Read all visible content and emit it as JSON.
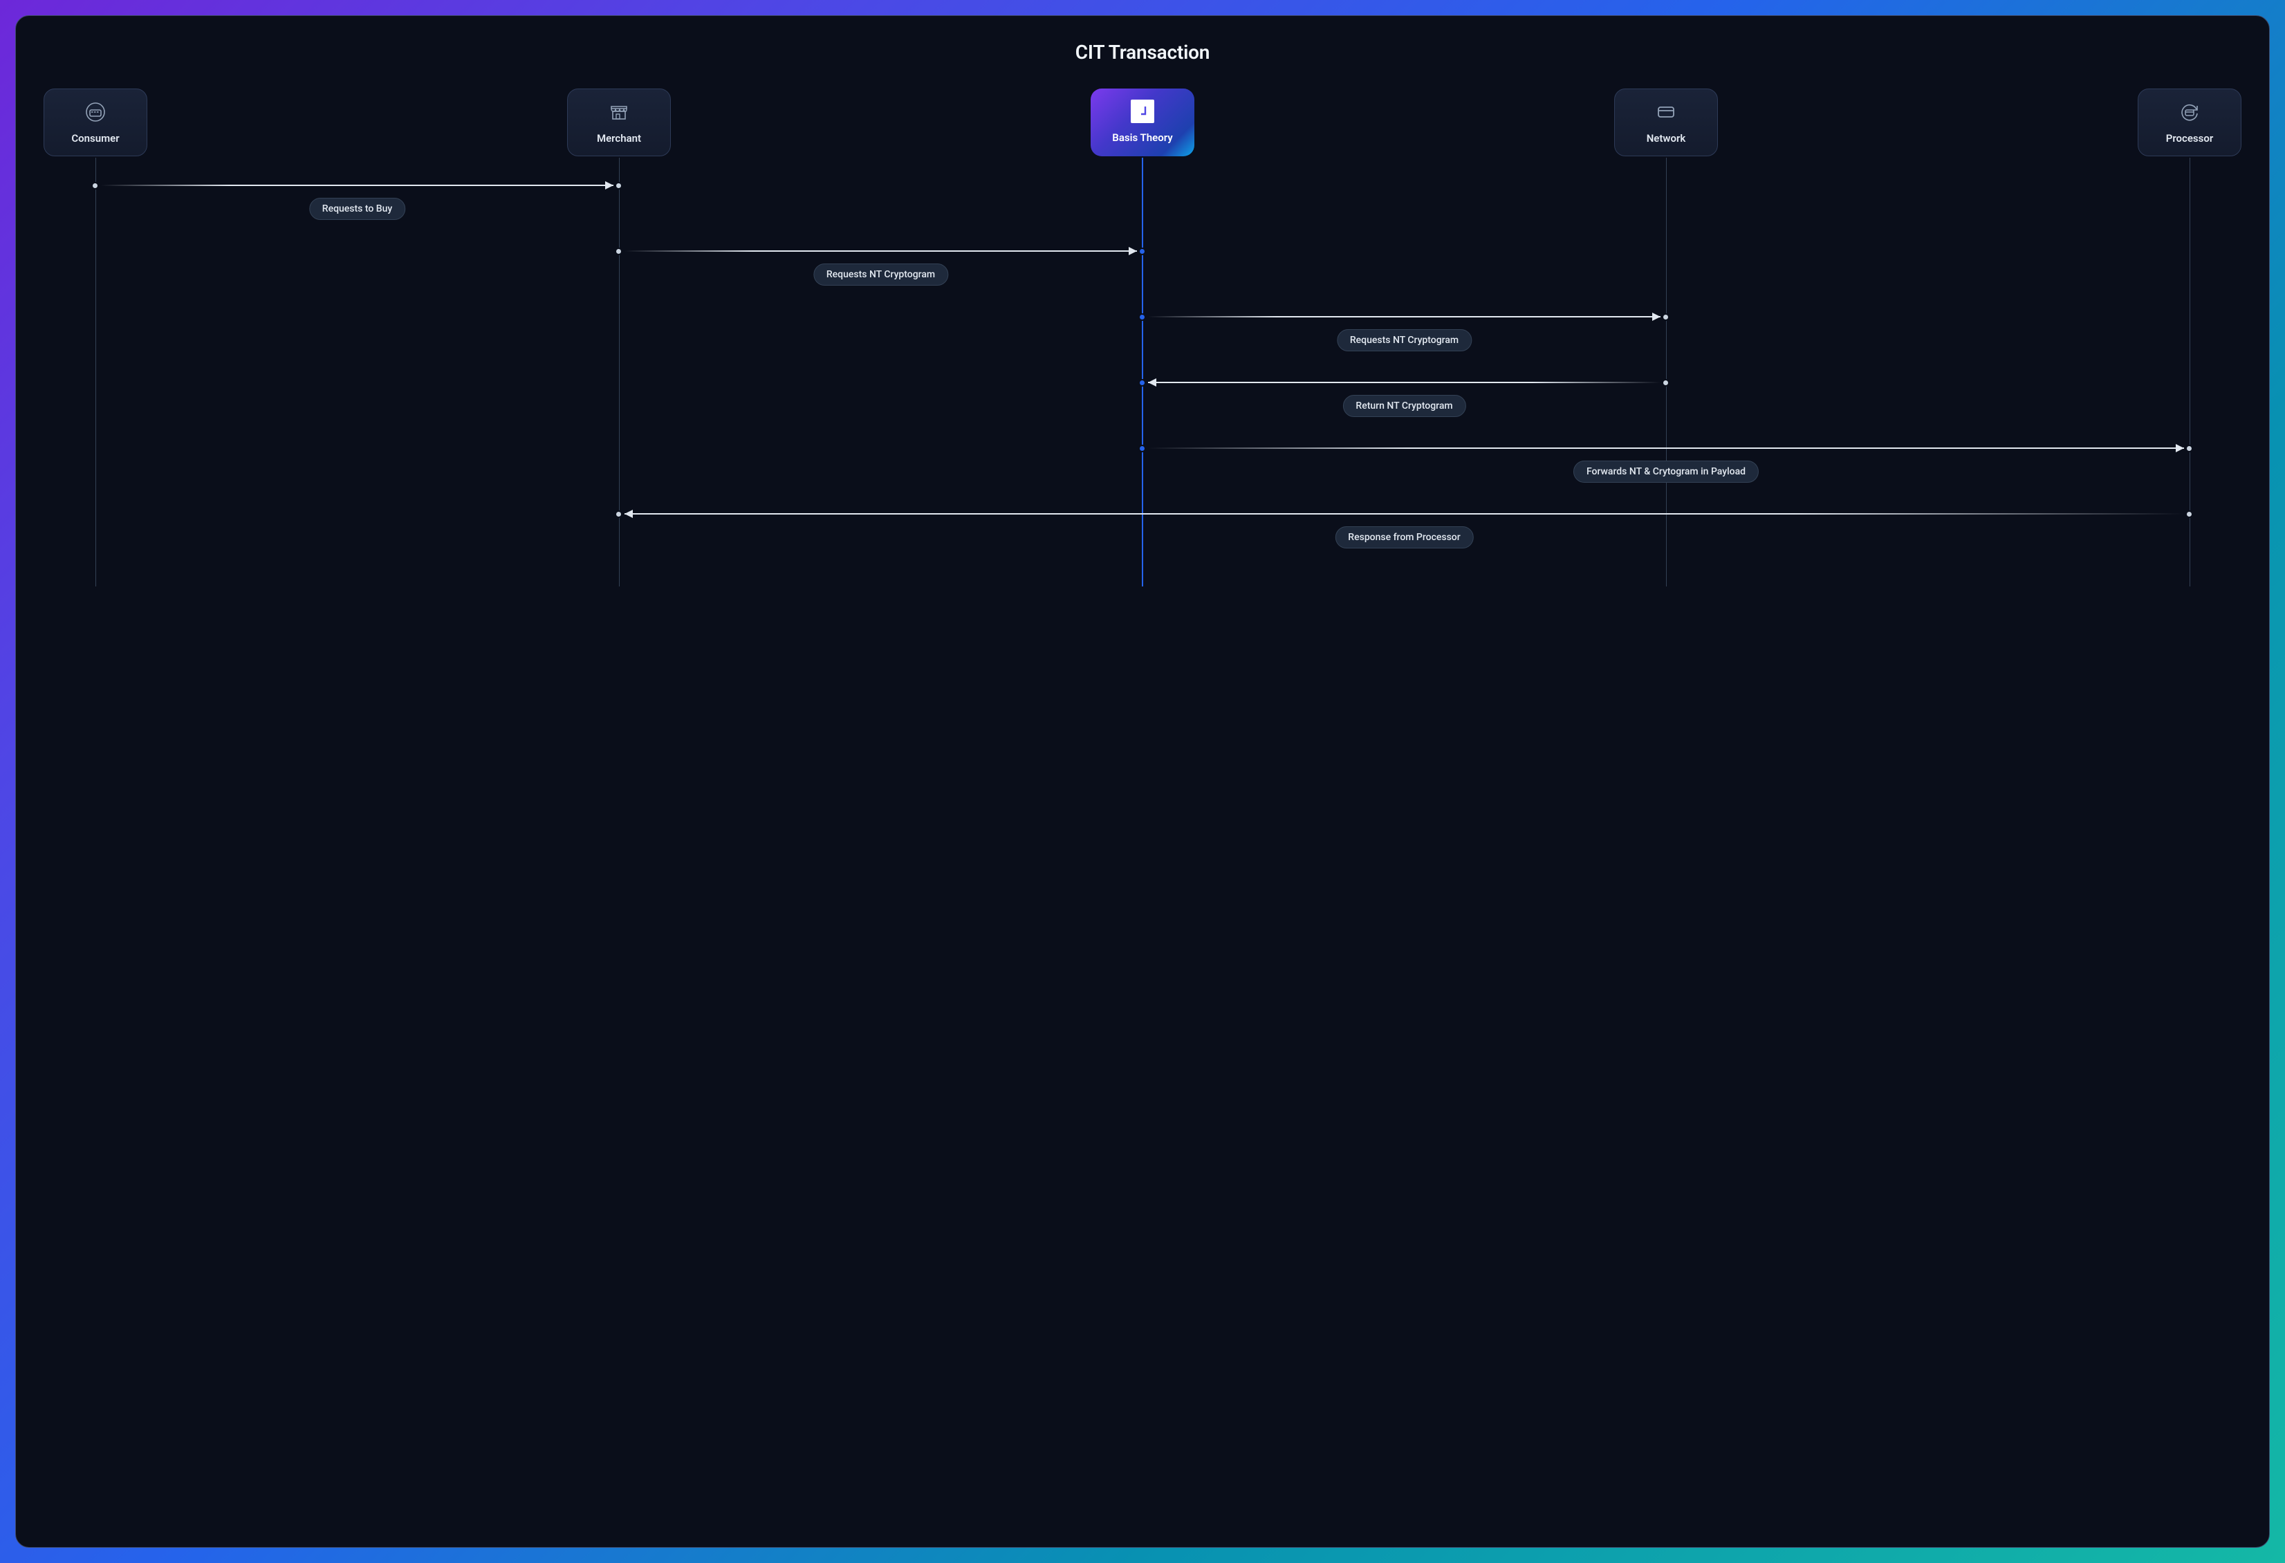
{
  "title": "CIT Transaction",
  "actors": [
    {
      "id": "consumer",
      "label": "Consumer",
      "icon": "card-reader",
      "highlight": false
    },
    {
      "id": "merchant",
      "label": "Merchant",
      "icon": "storefront",
      "highlight": false
    },
    {
      "id": "basistheory",
      "label": "Basis Theory",
      "icon": "basis-theory",
      "highlight": true
    },
    {
      "id": "network",
      "label": "Network",
      "icon": "credit-card",
      "highlight": false
    },
    {
      "id": "processor",
      "label": "Processor",
      "icon": "refresh-card",
      "highlight": false
    }
  ],
  "messages": [
    {
      "from": "consumer",
      "to": "merchant",
      "label": "Requests to Buy"
    },
    {
      "from": "merchant",
      "to": "basistheory",
      "label": "Requests NT Cryptogram"
    },
    {
      "from": "basistheory",
      "to": "network",
      "label": "Requests NT Cryptogram"
    },
    {
      "from": "network",
      "to": "basistheory",
      "label": "Return NT Cryptogram"
    },
    {
      "from": "basistheory",
      "to": "processor",
      "label": "Forwards NT & Crytogram in Payload"
    },
    {
      "from": "processor",
      "to": "merchant",
      "label": "Response from Processor"
    }
  ],
  "icons": {
    "card-reader": "card-reader-icon",
    "storefront": "storefront-icon",
    "credit-card": "credit-card-icon",
    "refresh-card": "refresh-card-icon",
    "basis-theory": "basis-theory-icon"
  },
  "colors": {
    "accent": "#2563eb",
    "panel_bg": "#0a0e1a"
  }
}
